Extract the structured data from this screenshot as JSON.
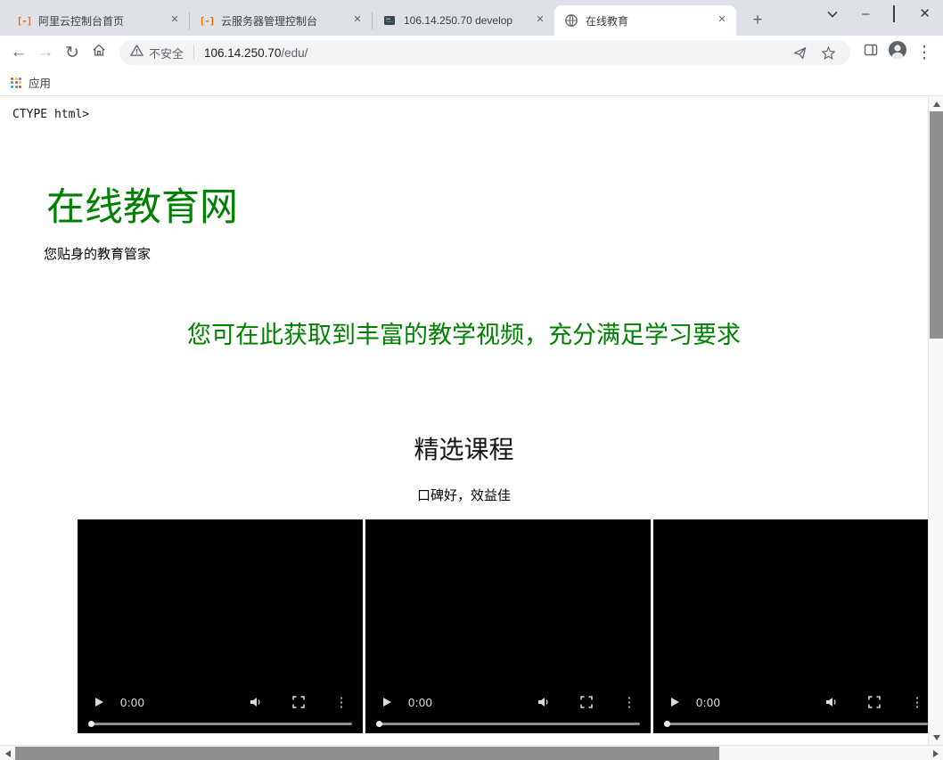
{
  "window": {
    "tabs": [
      {
        "title": "阿里云控制台首页"
      },
      {
        "title": "云服务器管理控制台"
      },
      {
        "title": "106.14.250.70 develop"
      },
      {
        "title": "在线教育"
      }
    ],
    "controls": {
      "new_tab": "+",
      "minimize": "–",
      "close": "✕"
    }
  },
  "toolbar": {
    "security_label": "不安全",
    "url_host": "106.14.250.70",
    "url_path": "/edu/"
  },
  "bookmarks": {
    "apps_label": "应用"
  },
  "icons": {
    "back": "←",
    "forward": "→",
    "reload": "↻",
    "tab_close": "✕",
    "menu_dots": "⋮",
    "overflow_dots": "⋮",
    "aliyun_logo": "[-]"
  },
  "page": {
    "doctype_fragment": "CTYPE html>",
    "site_title": "在线教育网",
    "site_subtitle": "您贴身的教育管家",
    "tagline": "您可在此获取到丰富的教学视频，充分满足学习要求",
    "featured_title": "精选课程",
    "featured_subtitle": "口碑好，效益佳",
    "videos": [
      {
        "current_time": "0:00"
      },
      {
        "current_time": "0:00"
      },
      {
        "current_time": "0:00"
      }
    ]
  },
  "colors": {
    "brand_green": "#008000",
    "aliyun_orange": "#ff6a00"
  }
}
